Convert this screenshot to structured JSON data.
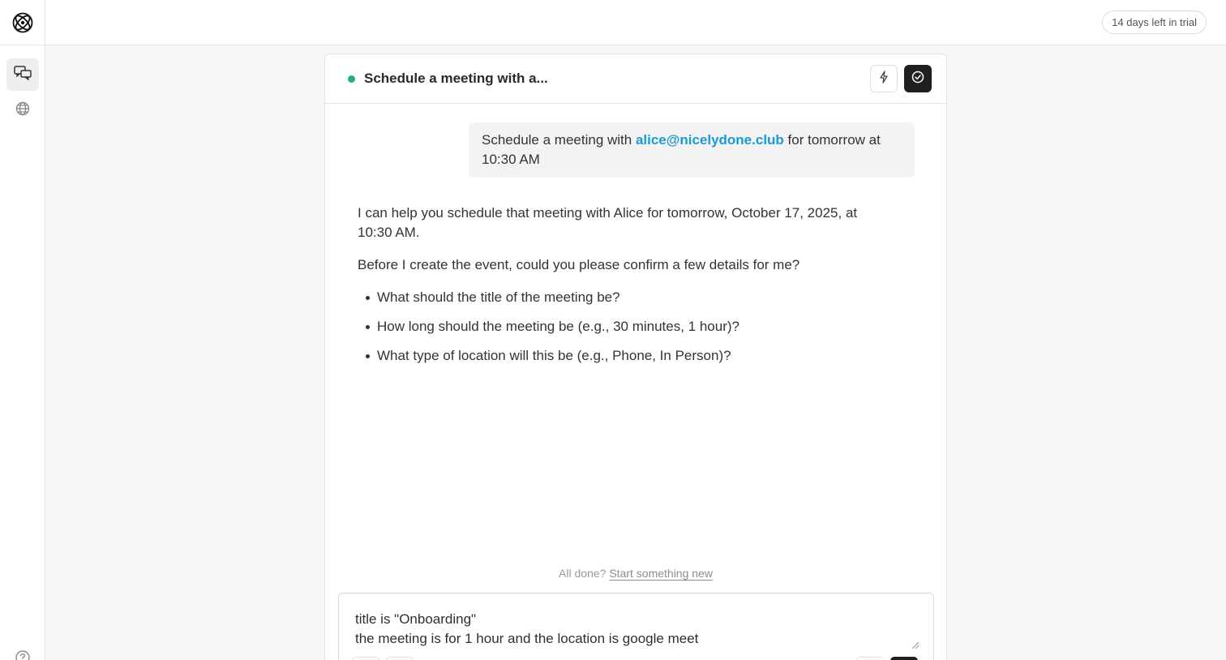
{
  "topbar": {
    "logo_icon": "atom-logo-icon",
    "trial_label": "14 days left in trial"
  },
  "sidebar": {
    "items": [
      {
        "icon": "chat-bubbles-icon",
        "active": true
      },
      {
        "icon": "globe-icon",
        "active": false
      }
    ],
    "help_icon": "help-circle-icon"
  },
  "chat": {
    "title": "Schedule a meeting with a...",
    "status_color": "#22b07d",
    "actions": [
      {
        "icon": "lightning-icon",
        "style": "light"
      },
      {
        "icon": "check-circle-icon",
        "style": "dark"
      }
    ],
    "user_message": {
      "before": "Schedule a meeting with ",
      "email": "alice@nicelydone.club",
      "after": " for tomorrow at 10:30 AM"
    },
    "assistant": {
      "para1": "I can help you schedule that meeting with Alice for tomorrow, October 17, 2025, at 10:30 AM.",
      "para2": "Before I create the event, could you please confirm a few details for me?",
      "bullets": [
        "What should the title of the meeting be?",
        "How long should the meeting be (e.g., 30 minutes, 1 hour)?",
        "What type of location will this be (e.g., Phone, In Person)?"
      ]
    },
    "footer": {
      "prompt": "All done?",
      "link": "Start something new"
    },
    "composer": {
      "value": "title is \"Onboarding\"\nthe meeting is for 1 hour and the location is google meet"
    }
  },
  "colors": {
    "accent_link": "#1a9ad6",
    "dark_button": "#1f1f1f"
  }
}
